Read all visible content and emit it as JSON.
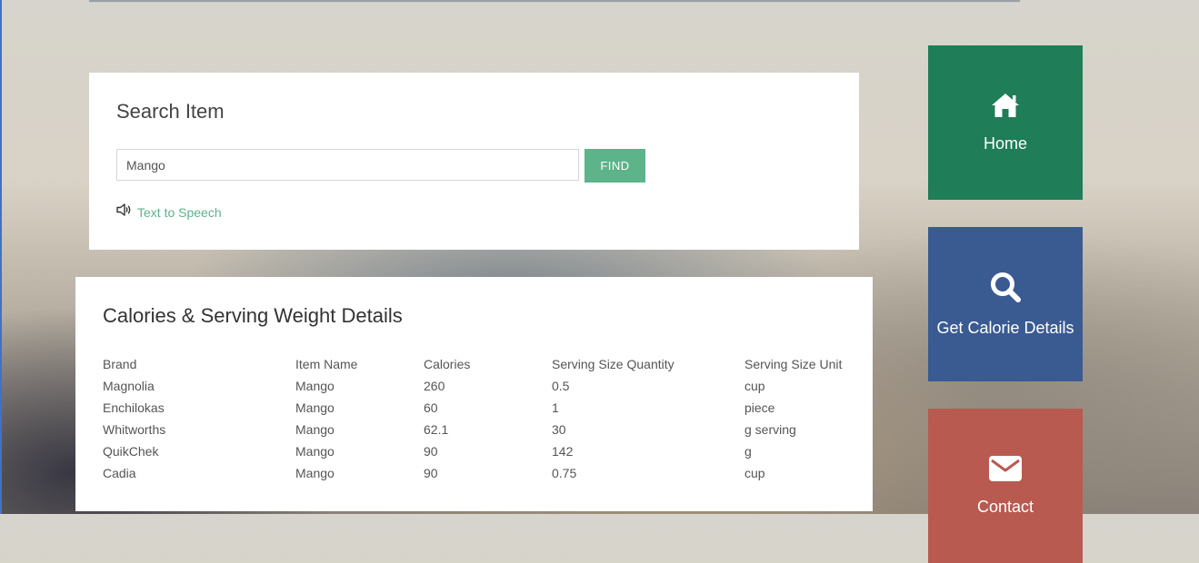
{
  "search": {
    "title": "Search Item",
    "input_value": "Mango",
    "find_label": "FIND",
    "tts_label": "Text to Speech"
  },
  "details": {
    "title": "Calories & Serving Weight Details",
    "columns": [
      "Brand",
      "Item Name",
      "Calories",
      "Serving Size Quantity",
      "Serving Size Unit"
    ],
    "rows": [
      [
        "Magnolia",
        "Mango",
        "260",
        "0.5",
        "cup"
      ],
      [
        "Enchilokas",
        "Mango",
        "60",
        "1",
        "piece"
      ],
      [
        "Whitworths",
        "Mango",
        "62.1",
        "30",
        "g serving"
      ],
      [
        "QuikChek",
        "Mango",
        "90",
        "142",
        "g"
      ],
      [
        "Cadia",
        "Mango",
        "90",
        "0.75",
        "cup"
      ]
    ]
  },
  "nav": {
    "home": {
      "label": "Home",
      "icon": "home-icon",
      "color": "#1f7d58"
    },
    "calorie": {
      "label": "Get Calorie Details",
      "icon": "search-icon",
      "color": "#3a5a92"
    },
    "contact": {
      "label": "Contact",
      "icon": "envelope-icon",
      "color": "#b85a50"
    }
  },
  "colors": {
    "accent": "#5db38a"
  }
}
